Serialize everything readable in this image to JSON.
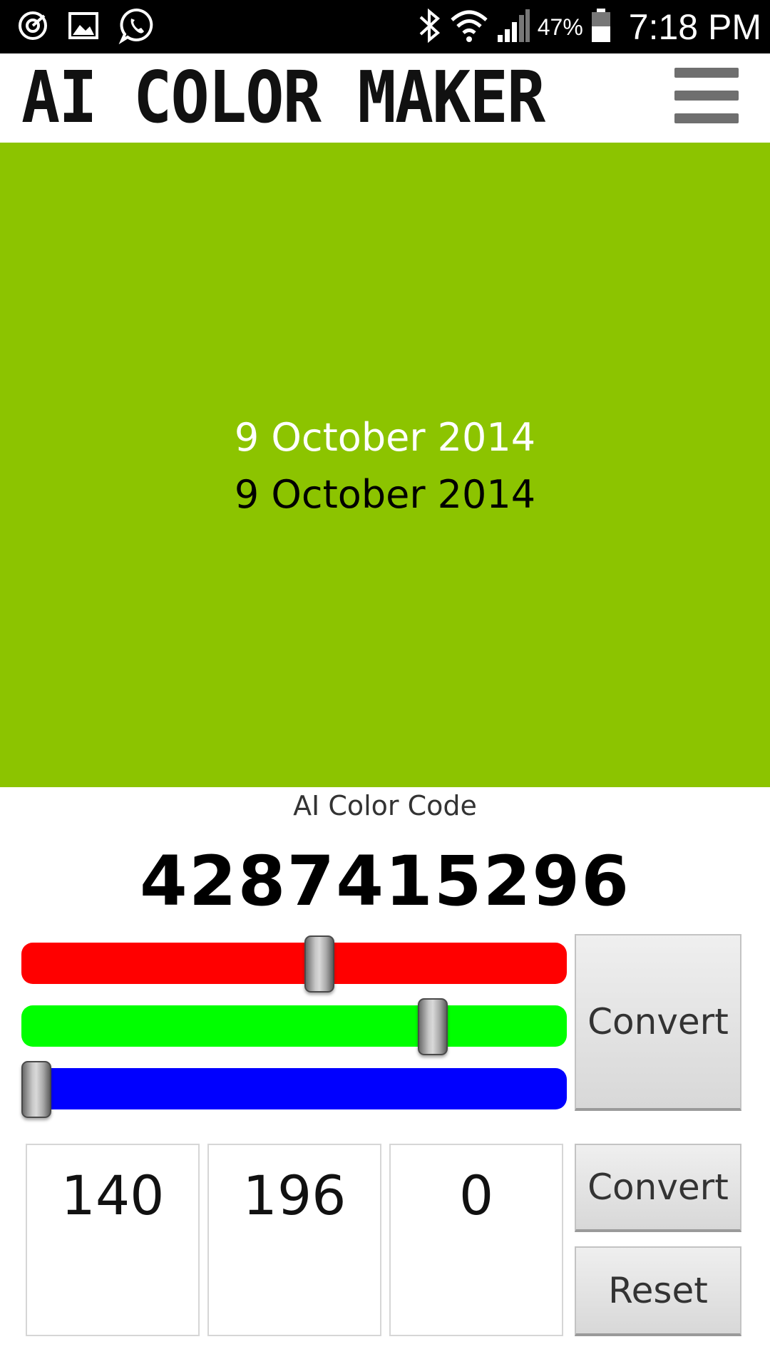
{
  "status_bar": {
    "time": "7:18 PM",
    "battery_percent": "47%",
    "left_icons": [
      "target-icon",
      "image-icon",
      "whatsapp-icon"
    ],
    "right_icons": [
      "bluetooth-icon",
      "wifi-icon",
      "signal-icon",
      "battery-icon"
    ]
  },
  "app_bar": {
    "title": "AI COLOR MAKER",
    "menu_icon": "hamburger-menu-icon"
  },
  "preview": {
    "background_color": "#8CC400",
    "date_light": "9 October 2014",
    "date_dark": "9 October 2014"
  },
  "color_code": {
    "label": "AI Color Code",
    "value": "4287415296"
  },
  "sliders": {
    "red": {
      "value": 140,
      "max": 255,
      "color": "#FF0000"
    },
    "green": {
      "value": 196,
      "max": 255,
      "color": "#00FF00"
    },
    "blue": {
      "value": 0,
      "max": 255,
      "color": "#0000FF"
    }
  },
  "inputs": {
    "red": "140",
    "green": "196",
    "blue": "0"
  },
  "buttons": {
    "convert_sliders": "Convert",
    "convert_inputs": "Convert",
    "reset": "Reset"
  }
}
